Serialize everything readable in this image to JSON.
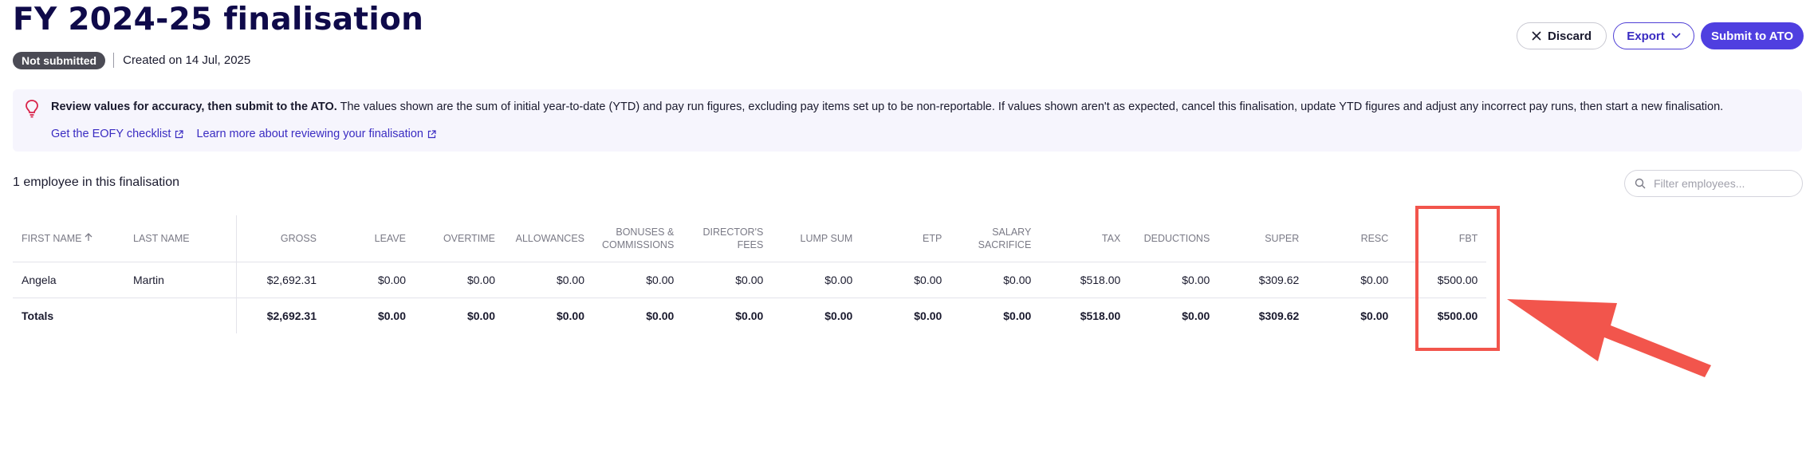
{
  "header": {
    "title": "FY 2024-25 finalisation",
    "status_badge": "Not submitted",
    "created_text": "Created on 14 Jul, 2025"
  },
  "actions": {
    "discard": "Discard",
    "export": "Export",
    "submit": "Submit to ATO"
  },
  "banner": {
    "bold_text": "Review values for accuracy, then submit to the ATO.",
    "body_text": " The values shown are the sum of initial year-to-date (YTD) and pay run figures, excluding pay items set up to be non-reportable. If values shown aren't as expected, cancel this finalisation, update YTD figures and adjust any incorrect pay runs, then start a new finalisation.",
    "link_checklist": "Get the EOFY checklist",
    "link_learn": "Learn more about reviewing your finalisation"
  },
  "list": {
    "count_text": "1 employee in this finalisation",
    "filter_placeholder": "Filter employees..."
  },
  "table": {
    "headers": {
      "first_name": "FIRST NAME",
      "last_name": "LAST NAME",
      "gross": "GROSS",
      "leave": "LEAVE",
      "overtime": "OVERTIME",
      "allowances": "ALLOWANCES",
      "bonuses_1": "BONUSES &",
      "bonuses_2": "COMMISSIONS",
      "directors_1": "DIRECTOR'S",
      "directors_2": "FEES",
      "lump_sum": "LUMP SUM",
      "etp": "ETP",
      "salary_1": "SALARY",
      "salary_2": "SACRIFICE",
      "tax": "TAX",
      "deductions": "DEDUCTIONS",
      "super": "SUPER",
      "resc": "RESC",
      "fbt": "FBT"
    },
    "row": {
      "first_name": "Angela",
      "last_name": "Martin",
      "gross": "$2,692.31",
      "leave": "$0.00",
      "overtime": "$0.00",
      "allowances": "$0.00",
      "bonuses": "$0.00",
      "directors": "$0.00",
      "lump_sum": "$0.00",
      "etp": "$0.00",
      "salary": "$0.00",
      "tax": "$518.00",
      "deductions": "$0.00",
      "super": "$309.62",
      "resc": "$0.00",
      "fbt": "$500.00"
    },
    "totals": {
      "label": "Totals",
      "gross": "$2,692.31",
      "leave": "$0.00",
      "overtime": "$0.00",
      "allowances": "$0.00",
      "bonuses": "$0.00",
      "directors": "$0.00",
      "lump_sum": "$0.00",
      "etp": "$0.00",
      "salary": "$0.00",
      "tax": "$518.00",
      "deductions": "$0.00",
      "super": "$309.62",
      "resc": "$0.00",
      "fbt": "$500.00"
    }
  },
  "annotation": {
    "color": "#f2554c"
  },
  "icons": {
    "discard": "close-icon",
    "export": "chevron-down-icon",
    "banner": "lightbulb-icon",
    "link": "external-link-icon",
    "filter": "search-icon",
    "sort": "arrow-up-icon"
  }
}
